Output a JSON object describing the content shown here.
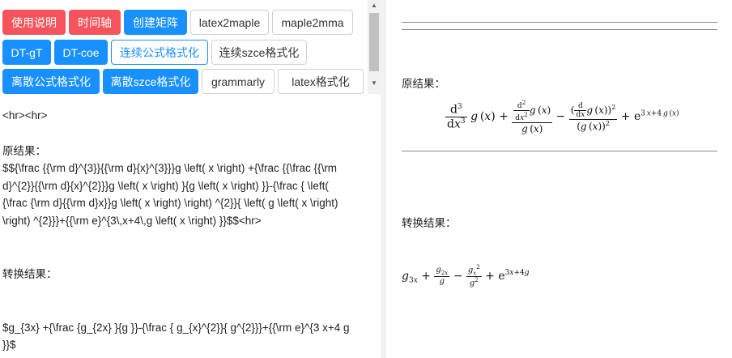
{
  "toolbar": {
    "buttons": [
      {
        "label": "使用说明"
      },
      {
        "label": "时间轴"
      },
      {
        "label": "创建矩阵"
      },
      {
        "label": "latex2maple"
      },
      {
        "label": "maple2mma"
      },
      {
        "label": "DT-gT"
      },
      {
        "label": "DT-coe"
      },
      {
        "label": "连续公式格式化"
      },
      {
        "label": "连续szce格式化"
      },
      {
        "label": "离散公式格式化"
      },
      {
        "label": "离散szce格式化"
      },
      {
        "label": "grammarly"
      },
      {
        "label": "latex格式化"
      }
    ]
  },
  "editor": {
    "lines": [
      "<hr><hr>",
      " 原结果：",
      "$${\\frac {{\\rm d}^{3}}{{\\rm d}{x}^{3}}}g \\left( x \\right) +{\\frac {{\\frac {{\\rm",
      "d}^{2}}{{\\rm d}{x}^{2}}}g \\left( x \\right) }{g \\left( x \\right) }}-{\\frac { \\left(",
      "{\\frac {\\rm d}{{\\rm d}x}}g \\left( x \\right)  \\right) ^{2}}{ \\left( g \\left( x \\right)",
      "\\right) ^{2}}}+{{\\rm e}^{3\\,x+4\\,g \\left( x \\right) }}$$<hr>",
      "转换结果：",
      "$g_{3x} +{\\frac {g_{2x} }{g }}-{\\frac { g_{x}^{2}}{ g^{2}}}+{{\\rm e}^{3 x+4 g",
      "}}$"
    ]
  },
  "preview": {
    "original_label": "原结果：",
    "converted_label": "转换结果："
  }
}
